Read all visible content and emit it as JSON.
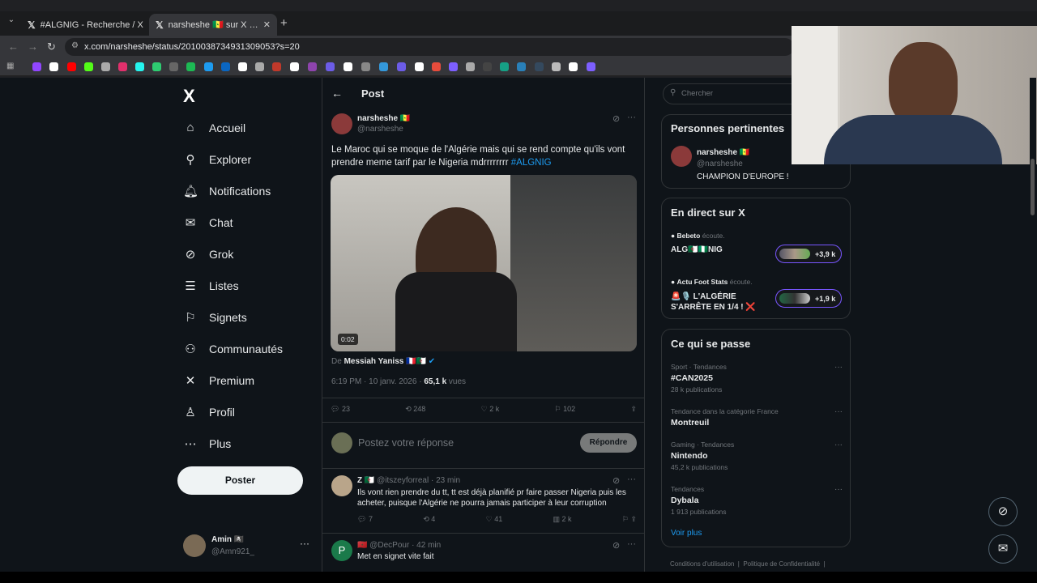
{
  "browser": {
    "tabs": [
      {
        "title": "#ALGNIG - Recherche / X"
      },
      {
        "title": "narsheshe 🇸🇳 sur X : \"Le Maroc"
      }
    ],
    "url": "x.com/narsheshe/status/2010038734931309053?s=20"
  },
  "nav": {
    "logo": "X",
    "items": [
      {
        "label": "Accueil",
        "icon": "home-icon"
      },
      {
        "label": "Explorer",
        "icon": "search-icon"
      },
      {
        "label": "Notifications",
        "icon": "bell-icon"
      },
      {
        "label": "Chat",
        "icon": "mail-icon"
      },
      {
        "label": "Grok",
        "icon": "grok-icon"
      },
      {
        "label": "Listes",
        "icon": "list-icon"
      },
      {
        "label": "Signets",
        "icon": "bookmark-icon"
      },
      {
        "label": "Communautés",
        "icon": "people-icon"
      },
      {
        "label": "Premium",
        "icon": "x-icon"
      },
      {
        "label": "Profil",
        "icon": "person-icon"
      },
      {
        "label": "Plus",
        "icon": "more-circle-icon"
      }
    ],
    "post_button": "Poster",
    "account": {
      "name": "Amin 🏴‍☠️",
      "handle": "@Amn921_"
    }
  },
  "post": {
    "header": "Post",
    "author": {
      "name": "narsheshe 🇸🇳",
      "handle": "@narsheshe"
    },
    "text": "Le Maroc qui se moque de l'Algérie mais qui se rend compte qu'ils vont prendre meme tarif par le Nigeria mdrrrrrrrr ",
    "hashtag": "#ALGNIG",
    "video_time": "0:02",
    "from_label": "De",
    "from_name": "Messiah Yaniss 🇫🇷🇩🇿",
    "time": "6:19 PM · 10 janv. 2026 · ",
    "views": "65,1 k",
    "views_label": "vues",
    "stats": {
      "replies": "23",
      "reposts": "248",
      "likes": "2 k",
      "bookmarks": "102"
    },
    "reply_placeholder": "Postez votre réponse",
    "reply_button": "Répondre"
  },
  "replies": [
    {
      "name": "Z 🇩🇿",
      "handle": "@itszeyforreal · 23 min",
      "text": "Ils vont rien prendre du tt, tt est déjà planifié pr faire passer Nigeria puis les acheter, puisque l'Algérie ne pourra jamais participer à leur corruption",
      "replies": "7",
      "reposts": "4",
      "likes": "41",
      "views": "2 k"
    },
    {
      "name": "🇲🇦",
      "handle": "@DecPour · 42 min",
      "text": "Met en signet vite fait",
      "avatar_letter": "P"
    }
  ],
  "search": {
    "placeholder": "Chercher"
  },
  "relevant": {
    "title": "Personnes pertinentes",
    "name": "narsheshe 🇸🇳",
    "handle": "@narsheshe",
    "bio": "CHAMPION D'EUROPE !"
  },
  "live": {
    "title": "En direct sur X",
    "items": [
      {
        "host": "Bebeto",
        "verb": "écoute.",
        "title": "ALG🇩🇿🇳🇬NIG",
        "count": "+3,9 k"
      },
      {
        "host": "Actu Foot Stats",
        "verb": "écoute.",
        "title": "🚨🎙️ L'ALGÉRIE S'ARRÊTE EN 1/4 ! ❌",
        "count": "+1,9 k"
      }
    ]
  },
  "happening": {
    "title": "Ce qui se passe",
    "trends": [
      {
        "meta": "Sport · Tendances",
        "name": "#CAN2025",
        "count": "28 k publications"
      },
      {
        "meta": "Tendance dans la catégorie France",
        "name": "Montreuil",
        "count": ""
      },
      {
        "meta": "Gaming · Tendances",
        "name": "Nintendo",
        "count": "45,2 k publications"
      },
      {
        "meta": "Tendances",
        "name": "Dybala",
        "count": "1 913 publications"
      }
    ],
    "more": "Voir plus"
  },
  "footer": {
    "links": [
      "Conditions d'utilisation",
      "Politique de Confidentialité"
    ]
  },
  "colors": {
    "bg": "#0f1419",
    "accent": "#1d9bf0",
    "border": "#2f3336"
  }
}
